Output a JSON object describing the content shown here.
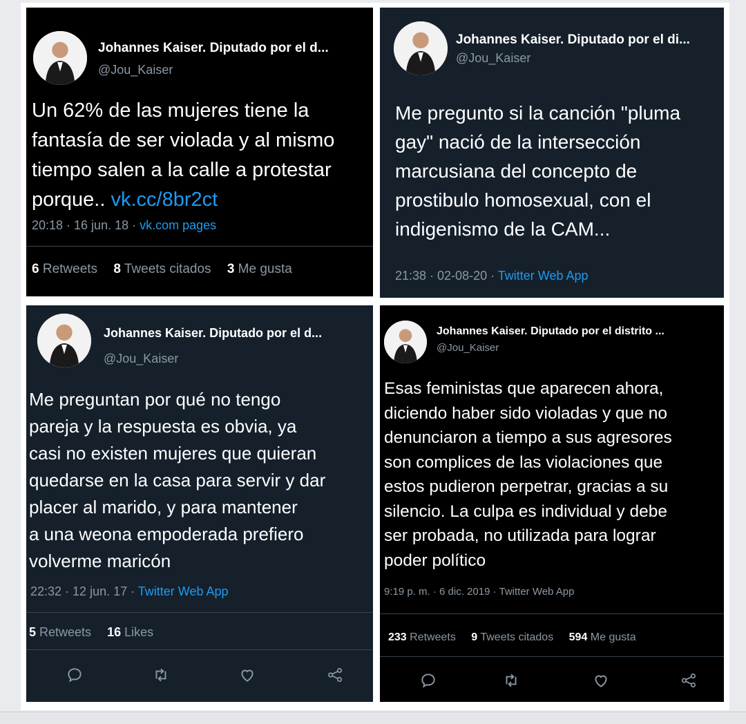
{
  "tweets": [
    {
      "name": "Johannes Kaiser. Diputado por el d...",
      "handle": "@Jou_Kaiser",
      "text": "Un 62% de las mujeres tiene la\nfantasía de ser violada y al mismo\ntiempo salen a la calle a protestar\nporque.. ",
      "link": "vk.cc/8br2ct",
      "time": "20:18 · 16 jun. 18 · ",
      "app": "vk.com pages",
      "stats": [
        {
          "count": "6",
          "label": " Retweets"
        },
        {
          "count": "8",
          "label": " Tweets citados"
        },
        {
          "count": "3",
          "label": " Me gusta"
        }
      ]
    },
    {
      "name": "Johannes Kaiser. Diputado por el di...",
      "handle": "@Jou_Kaiser",
      "text": "Me pregunto si la canción \"pluma\ngay\" nació de la intersección\nmarcusiana del concepto de\nprostibulo homosexual, con el\nindigenismo de la CAM...",
      "time": "21:38 · 02-08-20 · ",
      "app": "Twitter Web App"
    },
    {
      "name": "Johannes Kaiser. Diputado por el d...",
      "handle": "@Jou_Kaiser",
      "text": "Me preguntan por qué no tengo\npareja y la respuesta es obvia, ya\ncasi no existen mujeres que quieran\nquedarse en la casa para servir y dar\nplacer al marido, y para mantener\na una weona empoderada prefiero\nvolverme maricón",
      "time": "22:32 · 12 jun. 17 · ",
      "app": "Twitter Web App",
      "stats": [
        {
          "count": "5",
          "label": " Retweets"
        },
        {
          "count": "16",
          "label": " Likes"
        }
      ]
    },
    {
      "name": "Johannes Kaiser. Diputado por el distrito ...",
      "handle": "@Jou_Kaiser",
      "text": "Esas feministas que aparecen ahora,\ndiciendo haber sido violadas y que no\ndenunciaron a tiempo a sus agresores\nson complices de las violaciones que\nestos pudieron perpetrar, gracias a su\nsilencio. La culpa es individual y debe\nser probada, no utilizada para lograr\npoder político",
      "time": "9:19 p. m. · 6 dic. 2019 · ",
      "app": "Twitter Web App",
      "stats": [
        {
          "count": "233",
          "label": " Retweets"
        },
        {
          "count": "9",
          "label": " Tweets citados"
        },
        {
          "count": "594",
          "label": " Me gusta"
        }
      ]
    }
  ],
  "icons": [
    "reply-icon",
    "retweet-icon",
    "like-icon",
    "share-icon"
  ],
  "colors": {
    "dark_bg": "#15202b",
    "black_bg": "#000000",
    "link": "#1d9bf0",
    "muted": "#8b98a5"
  }
}
